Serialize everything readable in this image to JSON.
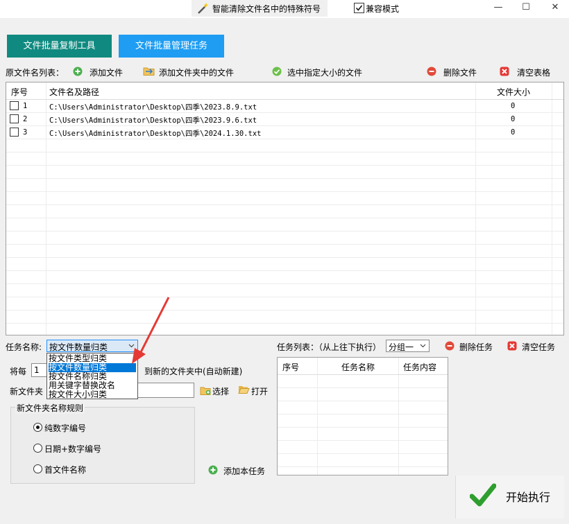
{
  "window": {
    "title": "智能清除文件名中的特殊符号",
    "compat_mode_label": "兼容模式",
    "compat_mode_checked": true,
    "minimize": "—",
    "maximize": "☐",
    "close": "✕"
  },
  "tabs": [
    {
      "label": "文件批量复制工具",
      "color": "#108a80"
    },
    {
      "label": "文件批量管理任务",
      "color": "#1e9df2"
    }
  ],
  "toolbar": {
    "source_list_label": "原文件名列表：",
    "add_file": "添加文件",
    "add_folder_files": "添加文件夹中的文件",
    "select_by_size": "选中指定大小的文件",
    "delete_file": "删除文件",
    "clear_table": "清空表格"
  },
  "file_table": {
    "columns": [
      "序号",
      "文件名及路径",
      "文件大小"
    ],
    "rows": [
      {
        "index": "1",
        "path": "C:\\Users\\Administrator\\Desktop\\四季\\2023.8.9.txt",
        "size": "0"
      },
      {
        "index": "2",
        "path": "C:\\Users\\Administrator\\Desktop\\四季\\2023.9.6.txt",
        "size": "0"
      },
      {
        "index": "3",
        "path": "C:\\Users\\Administrator\\Desktop\\四季\\2024.1.30.txt",
        "size": "0"
      }
    ]
  },
  "task": {
    "name_label": "任务名称:",
    "selected": "按文件数量归类",
    "options": [
      "按文件类型归类",
      "按文件数量归类",
      "按文件名称归类",
      "用关键字替换改名",
      "按文件大小归类"
    ],
    "every_label": "将每",
    "every_value": "1",
    "to_new_folder": "到新的文件夹中(自动新建)",
    "new_folder_label": "新文件夹",
    "choose_button": "选择",
    "open_button": "打开",
    "rule_group_title": "新文件夹名称规则",
    "rules": [
      {
        "label": "纯数字编号",
        "checked": true
      },
      {
        "label": "日期+数字编号",
        "checked": false
      },
      {
        "label": "首文件名称",
        "checked": false
      }
    ],
    "add_task_button": "添加本任务"
  },
  "task_list": {
    "label": "任务列表：（从上往下执行）",
    "group_selected": "分组一",
    "delete_task": "删除任务",
    "clear_task": "清空任务",
    "columns": [
      "序号",
      "任务名称",
      "任务内容"
    ]
  },
  "execute_button": "开始执行",
  "colors": {
    "accent": "#1e9df2",
    "annotation_arrow": "#e53935",
    "selection": "#0078d7"
  }
}
